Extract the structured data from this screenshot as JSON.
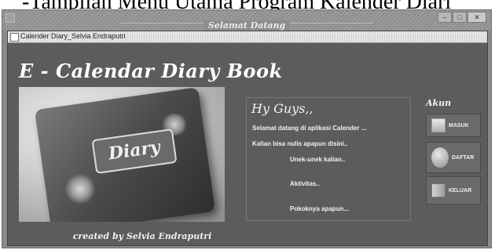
{
  "caption": {
    "text": "-Tampilan Menu Utama Program Kalender Diari"
  },
  "window": {
    "title": "Selamat Datang",
    "controls": [
      "minimize",
      "maximize",
      "close"
    ]
  },
  "internal_frame": {
    "title": "Calender Diary_Selvia Endraputri"
  },
  "heading": "E - Calendar Diary Book",
  "photo": {
    "label": "Diary"
  },
  "credit": "created by Selvia Endraputri",
  "greeting": {
    "hello": "Hy Guys,,",
    "lines": [
      "Selamat datang di aplikasi Calender ...",
      "Kalian bisa nulis apapun disini..",
      "Unek-unek kalian..",
      "Aktivitas..",
      "Pokoknya apapun..."
    ]
  },
  "akun": {
    "title": "Akun",
    "buttons": [
      {
        "label": "MASUK",
        "icon": "login-icon"
      },
      {
        "label": "DAFTAR",
        "icon": "user-icon"
      },
      {
        "label": "KELUAR",
        "icon": "exit-door-icon"
      }
    ]
  }
}
